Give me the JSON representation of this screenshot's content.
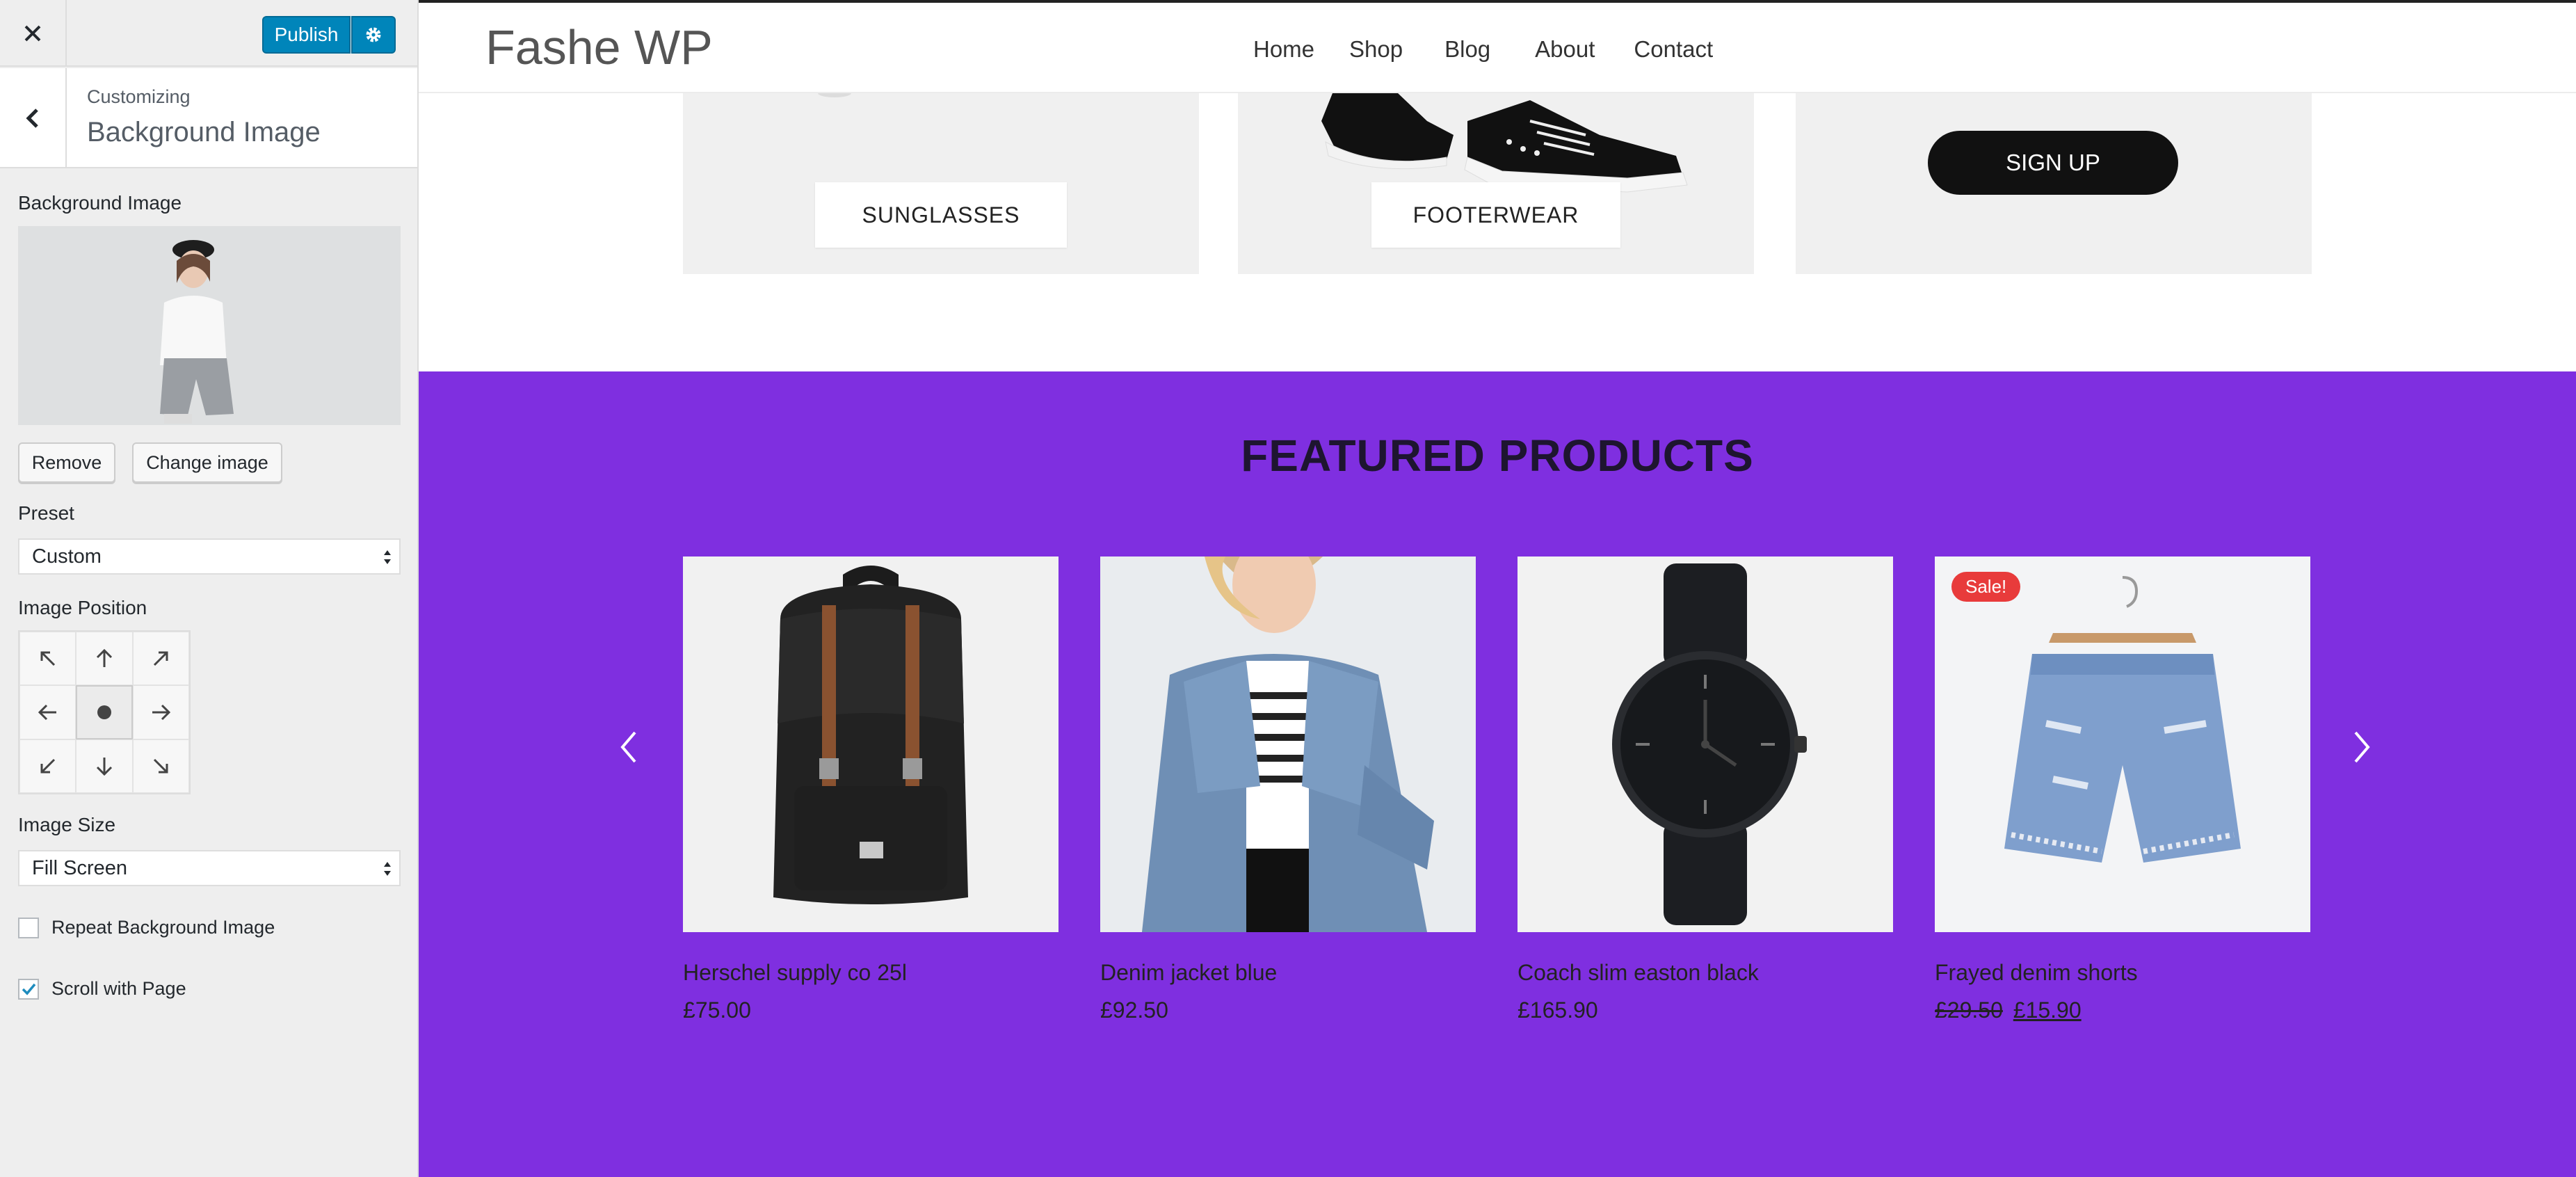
{
  "customizer": {
    "publish_label": "Publish",
    "customizing_label": "Customizing",
    "section_title": "Background Image",
    "background_image_label": "Background Image",
    "remove_label": "Remove",
    "change_image_label": "Change image",
    "preset_label": "Preset",
    "preset_value": "Custom",
    "image_position_label": "Image Position",
    "image_size_label": "Image Size",
    "image_size_value": "Fill Screen",
    "repeat_label": "Repeat Background Image",
    "repeat_checked": false,
    "scroll_label": "Scroll with Page",
    "scroll_checked": true,
    "accent_color": "#0085ba"
  },
  "site": {
    "logo": "Fashe WP",
    "nav": [
      "Home",
      "Shop",
      "Blog",
      "About",
      "Contact"
    ],
    "categories": [
      "SUNGLASSES",
      "FOOTERWEAR"
    ],
    "signup_label": "SIGN UP",
    "featured_title": "FEATURED PRODUCTS",
    "featured_bg": "#7f2fe0",
    "products": [
      {
        "name": "Herschel supply co 25l",
        "price": "£75.00"
      },
      {
        "name": "Denim jacket blue",
        "price": "£92.50"
      },
      {
        "name": "Coach slim easton black",
        "price": "£165.90"
      },
      {
        "name": "Frayed denim shorts",
        "old_price": "£29.50",
        "price": "£15.90",
        "badge": "Sale!"
      }
    ]
  }
}
